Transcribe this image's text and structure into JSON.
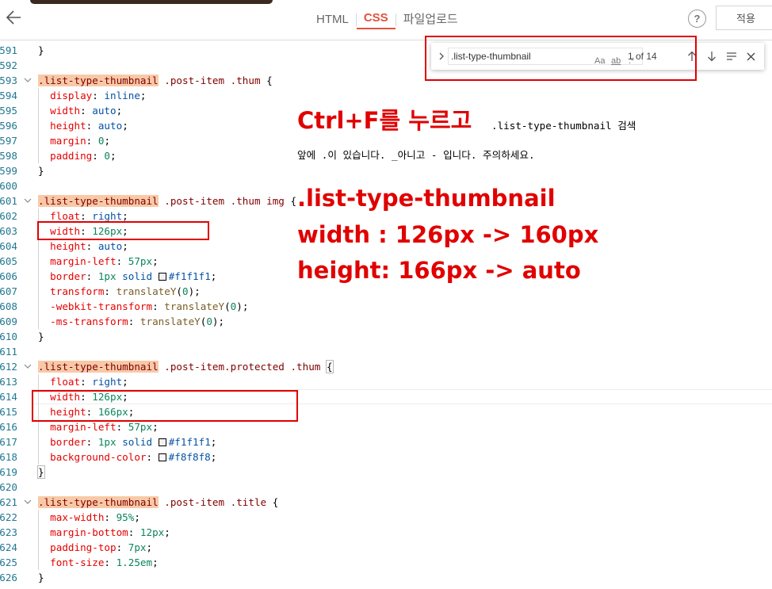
{
  "header": {
    "tabs": [
      {
        "label": "HTML",
        "active": false
      },
      {
        "label": "CSS",
        "active": true
      },
      {
        "label": "파일업로드",
        "active": false
      }
    ],
    "help_label": "?",
    "apply_label": "적용"
  },
  "find_widget": {
    "query": ".list-type-thumbnail",
    "match_case_label": "Aa",
    "whole_word_label": "ab",
    "regex_label": ".*",
    "result_count": "1 of 14"
  },
  "code_lines": [
    {
      "n": "591",
      "tokens": [
        {
          "t": "}",
          "c": "pn"
        }
      ]
    },
    {
      "n": "592",
      "tokens": []
    },
    {
      "n": "593",
      "fold": true,
      "tokens": [
        {
          "t": ".list-type-thumbnail",
          "c": "sel",
          "hl": true
        },
        {
          "t": " .post-item .thum ",
          "c": "sel"
        },
        {
          "t": "{",
          "c": "pn"
        }
      ]
    },
    {
      "n": "594",
      "tokens": [
        {
          "t": "  display",
          "c": "prop"
        },
        {
          "t": ": ",
          "c": "pn"
        },
        {
          "t": "inline",
          "c": "val"
        },
        {
          "t": ";",
          "c": "pn"
        }
      ]
    },
    {
      "n": "595",
      "tokens": [
        {
          "t": "  width",
          "c": "prop"
        },
        {
          "t": ": ",
          "c": "pn"
        },
        {
          "t": "auto",
          "c": "val"
        },
        {
          "t": ";",
          "c": "pn"
        }
      ]
    },
    {
      "n": "596",
      "tokens": [
        {
          "t": "  height",
          "c": "prop"
        },
        {
          "t": ": ",
          "c": "pn"
        },
        {
          "t": "auto",
          "c": "val"
        },
        {
          "t": ";",
          "c": "pn"
        }
      ]
    },
    {
      "n": "597",
      "tokens": [
        {
          "t": "  margin",
          "c": "prop"
        },
        {
          "t": ": ",
          "c": "pn"
        },
        {
          "t": "0",
          "c": "num"
        },
        {
          "t": ";",
          "c": "pn"
        }
      ]
    },
    {
      "n": "598",
      "tokens": [
        {
          "t": "  padding",
          "c": "prop"
        },
        {
          "t": ": ",
          "c": "pn"
        },
        {
          "t": "0",
          "c": "num"
        },
        {
          "t": ";",
          "c": "pn"
        }
      ]
    },
    {
      "n": "599",
      "tokens": [
        {
          "t": "}",
          "c": "pn"
        }
      ]
    },
    {
      "n": "600",
      "tokens": []
    },
    {
      "n": "601",
      "fold": true,
      "tokens": [
        {
          "t": ".list-type-thumbnail",
          "c": "sel",
          "hl": true
        },
        {
          "t": " .post-item .thum img ",
          "c": "sel"
        },
        {
          "t": "{",
          "c": "pn"
        }
      ]
    },
    {
      "n": "602",
      "tokens": [
        {
          "t": "  float",
          "c": "prop"
        },
        {
          "t": ": ",
          "c": "pn"
        },
        {
          "t": "right",
          "c": "val"
        },
        {
          "t": ";",
          "c": "pn"
        }
      ]
    },
    {
      "n": "603",
      "tokens": [
        {
          "t": "  width",
          "c": "prop"
        },
        {
          "t": ": ",
          "c": "pn"
        },
        {
          "t": "126px",
          "c": "num"
        },
        {
          "t": ";",
          "c": "pn"
        }
      ]
    },
    {
      "n": "604",
      "tokens": [
        {
          "t": "  height",
          "c": "prop"
        },
        {
          "t": ": ",
          "c": "pn"
        },
        {
          "t": "auto",
          "c": "val"
        },
        {
          "t": ";",
          "c": "pn"
        }
      ]
    },
    {
      "n": "605",
      "tokens": [
        {
          "t": "  margin-left",
          "c": "prop"
        },
        {
          "t": ": ",
          "c": "pn"
        },
        {
          "t": "57px",
          "c": "num"
        },
        {
          "t": ";",
          "c": "pn"
        }
      ]
    },
    {
      "n": "606",
      "tokens": [
        {
          "t": "  border",
          "c": "prop"
        },
        {
          "t": ": ",
          "c": "pn"
        },
        {
          "t": "1px",
          "c": "num"
        },
        {
          "t": " ",
          "c": "pn"
        },
        {
          "t": "solid",
          "c": "val"
        },
        {
          "t": " ",
          "c": "pn"
        },
        {
          "t": "",
          "c": "swatch",
          "color": "#f1f1f1"
        },
        {
          "t": "#f1f1f1",
          "c": "val"
        },
        {
          "t": ";",
          "c": "pn"
        }
      ]
    },
    {
      "n": "607",
      "tokens": [
        {
          "t": "  transform",
          "c": "prop"
        },
        {
          "t": ": ",
          "c": "pn"
        },
        {
          "t": "translateY",
          "c": "fn"
        },
        {
          "t": "(",
          "c": "pn"
        },
        {
          "t": "0",
          "c": "num"
        },
        {
          "t": ");",
          "c": "pn"
        }
      ]
    },
    {
      "n": "608",
      "tokens": [
        {
          "t": "  -webkit-transform",
          "c": "prop"
        },
        {
          "t": ": ",
          "c": "pn"
        },
        {
          "t": "translateY",
          "c": "fn"
        },
        {
          "t": "(",
          "c": "pn"
        },
        {
          "t": "0",
          "c": "num"
        },
        {
          "t": ");",
          "c": "pn"
        }
      ]
    },
    {
      "n": "609",
      "tokens": [
        {
          "t": "  -ms-transform",
          "c": "prop"
        },
        {
          "t": ": ",
          "c": "pn"
        },
        {
          "t": "translateY",
          "c": "fn"
        },
        {
          "t": "(",
          "c": "pn"
        },
        {
          "t": "0",
          "c": "num"
        },
        {
          "t": ");",
          "c": "pn"
        }
      ]
    },
    {
      "n": "610",
      "tokens": [
        {
          "t": "}",
          "c": "pn"
        }
      ]
    },
    {
      "n": "611",
      "tokens": []
    },
    {
      "n": "612",
      "fold": true,
      "tokens": [
        {
          "t": ".list-type-thumbnail",
          "c": "sel",
          "hl": true
        },
        {
          "t": " .post-item.protected .thum ",
          "c": "sel"
        },
        {
          "t": "{",
          "c": "pn",
          "brk": true
        }
      ]
    },
    {
      "n": "613",
      "tokens": [
        {
          "t": "  float",
          "c": "prop"
        },
        {
          "t": ": ",
          "c": "pn"
        },
        {
          "t": "right",
          "c": "val"
        },
        {
          "t": ";",
          "c": "pn"
        }
      ]
    },
    {
      "n": "614",
      "current": true,
      "tokens": [
        {
          "t": "  width",
          "c": "prop"
        },
        {
          "t": ": ",
          "c": "pn"
        },
        {
          "t": "126px",
          "c": "num"
        },
        {
          "t": ";",
          "c": "pn"
        }
      ]
    },
    {
      "n": "615",
      "tokens": [
        {
          "t": "  height",
          "c": "prop"
        },
        {
          "t": ": ",
          "c": "pn"
        },
        {
          "t": "166px",
          "c": "num"
        },
        {
          "t": ";",
          "c": "pn"
        }
      ]
    },
    {
      "n": "616",
      "tokens": [
        {
          "t": "  margin-left",
          "c": "prop"
        },
        {
          "t": ": ",
          "c": "pn"
        },
        {
          "t": "57px",
          "c": "num"
        },
        {
          "t": ";",
          "c": "pn"
        }
      ]
    },
    {
      "n": "617",
      "tokens": [
        {
          "t": "  border",
          "c": "prop"
        },
        {
          "t": ": ",
          "c": "pn"
        },
        {
          "t": "1px",
          "c": "num"
        },
        {
          "t": " ",
          "c": "pn"
        },
        {
          "t": "solid",
          "c": "val"
        },
        {
          "t": " ",
          "c": "pn"
        },
        {
          "t": "",
          "c": "swatch",
          "color": "#f1f1f1"
        },
        {
          "t": "#f1f1f1",
          "c": "val"
        },
        {
          "t": ";",
          "c": "pn"
        }
      ]
    },
    {
      "n": "618",
      "tokens": [
        {
          "t": "  background-color",
          "c": "prop"
        },
        {
          "t": ": ",
          "c": "pn"
        },
        {
          "t": "",
          "c": "swatch",
          "color": "#f8f8f8"
        },
        {
          "t": "#f8f8f8",
          "c": "val"
        },
        {
          "t": ";",
          "c": "pn"
        }
      ]
    },
    {
      "n": "619",
      "tokens": [
        {
          "t": "}",
          "c": "pn",
          "brk": true
        }
      ]
    },
    {
      "n": "620",
      "tokens": []
    },
    {
      "n": "621",
      "fold": true,
      "tokens": [
        {
          "t": ".list-type-thumbnail",
          "c": "sel",
          "hl": true
        },
        {
          "t": " .post-item .title ",
          "c": "sel"
        },
        {
          "t": "{",
          "c": "pn"
        }
      ]
    },
    {
      "n": "622",
      "tokens": [
        {
          "t": "  max-width",
          "c": "prop"
        },
        {
          "t": ": ",
          "c": "pn"
        },
        {
          "t": "95%",
          "c": "num"
        },
        {
          "t": ";",
          "c": "pn"
        }
      ]
    },
    {
      "n": "623",
      "tokens": [
        {
          "t": "  margin-bottom",
          "c": "prop"
        },
        {
          "t": ": ",
          "c": "pn"
        },
        {
          "t": "12px",
          "c": "num"
        },
        {
          "t": ";",
          "c": "pn"
        }
      ]
    },
    {
      "n": "624",
      "tokens": [
        {
          "t": "  padding-top",
          "c": "prop"
        },
        {
          "t": ": ",
          "c": "pn"
        },
        {
          "t": "7px",
          "c": "num"
        },
        {
          "t": ";",
          "c": "pn"
        }
      ]
    },
    {
      "n": "625",
      "tokens": [
        {
          "t": "  font-size",
          "c": "prop"
        },
        {
          "t": ": ",
          "c": "pn"
        },
        {
          "t": "1.25em",
          "c": "num"
        },
        {
          "t": ";",
          "c": "pn"
        }
      ]
    },
    {
      "n": "626",
      "tokens": [
        {
          "t": "}",
          "c": "pn"
        }
      ]
    }
  ],
  "annotations": {
    "ctrl_f": "Ctrl+F를 누르고",
    "ctrl_f_query": ".list-type-thumbnail 검색",
    "note": "앞에 .이 있습니다. _아니고 - 입니다. 주의하세요.",
    "selector": ".list-type-thumbnail",
    "width_change": "width : 126px -> 160px",
    "height_change": "height: 166px -> auto"
  },
  "colors": {
    "accent": "#e2523c",
    "annotation_red": "#e00000",
    "selector_highlight": "#f8c9a7"
  }
}
